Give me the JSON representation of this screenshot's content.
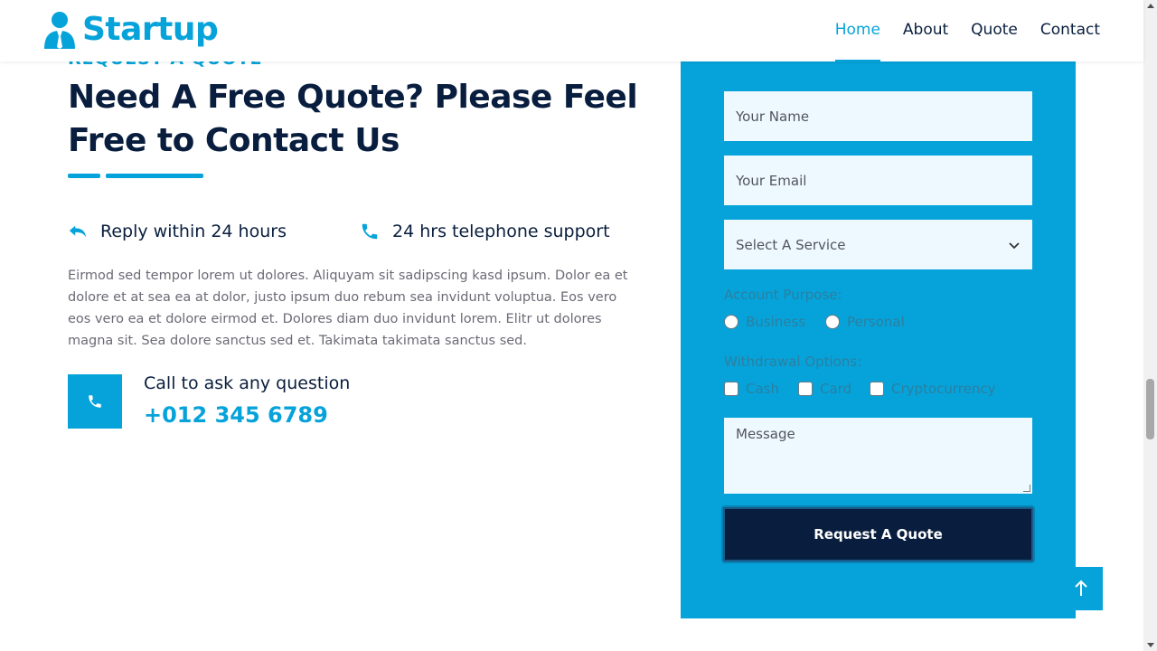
{
  "brand": {
    "name": "Startup",
    "icon": "user-tie-icon"
  },
  "nav": {
    "items": [
      {
        "label": "Home",
        "active": true
      },
      {
        "label": "About",
        "active": false
      },
      {
        "label": "Quote",
        "active": false
      },
      {
        "label": "Contact",
        "active": false
      }
    ]
  },
  "section": {
    "tag": "REQUEST A QUOTE",
    "heading": "Need A Free Quote? Please Feel Free to Contact Us",
    "features": [
      {
        "icon": "reply-icon",
        "text": "Reply within 24 hours"
      },
      {
        "icon": "phone-icon",
        "text": "24 hrs telephone support"
      }
    ],
    "body": "Eirmod sed tempor lorem ut dolores. Aliquyam sit sadipscing kasd ipsum. Dolor ea et dolore et at sea ea at dolor, justo ipsum duo rebum sea invidunt voluptua. Eos vero eos vero ea et dolore eirmod et. Dolores diam duo invidunt lorem. Elitr ut dolores magna sit. Sea dolore sanctus sed et. Takimata takimata sanctus sed.",
    "call": {
      "label": "Call to ask any question",
      "number": "+012 345 6789"
    }
  },
  "form": {
    "name_placeholder": "Your Name",
    "email_placeholder": "Your Email",
    "service_selected": "Select A Service",
    "purpose_label": "Account Purpose:",
    "purpose_options": [
      "Business",
      "Personal"
    ],
    "withdrawal_label": "Withdrawal Options:",
    "withdrawal_options": [
      "Cash",
      "Card",
      "Cryptocurrency"
    ],
    "message_placeholder": "Message",
    "submit_label": "Request A Quote"
  },
  "colors": {
    "primary": "#06A3DA",
    "dark": "#091E3E",
    "light": "#EEF9FF"
  }
}
